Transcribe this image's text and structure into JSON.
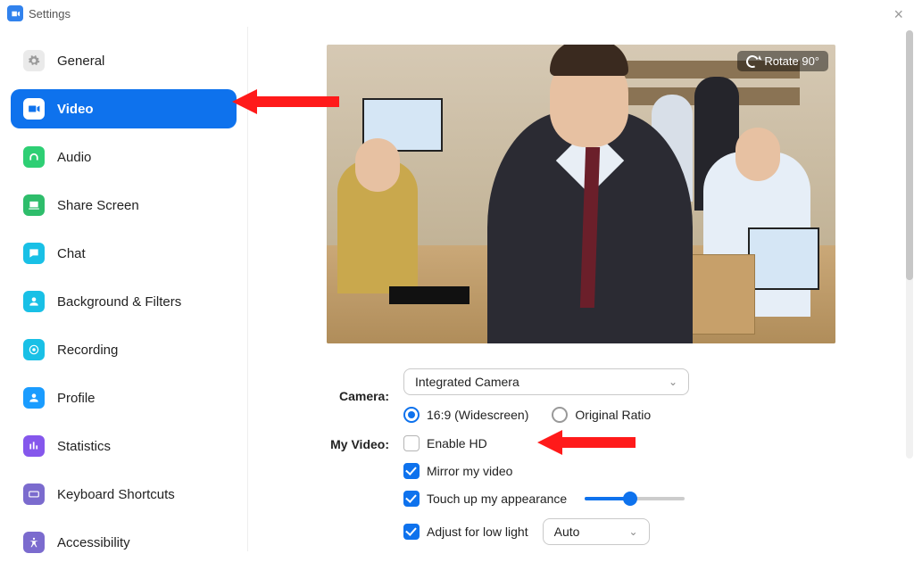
{
  "window": {
    "title": "Settings",
    "close": "×"
  },
  "sidebar": {
    "items": [
      {
        "label": "General",
        "icon_bg": "#eaeaea",
        "icon": "gear",
        "active": false,
        "icon_fill": "#9a9a9a"
      },
      {
        "label": "Video",
        "icon_bg": "#ffffff",
        "icon": "video",
        "active": true,
        "icon_fill": "#0e72ed"
      },
      {
        "label": "Audio",
        "icon_bg": "#2ecf74",
        "icon": "head",
        "active": false
      },
      {
        "label": "Share Screen",
        "icon_bg": "#2ebd6b",
        "icon": "share",
        "active": false
      },
      {
        "label": "Chat",
        "icon_bg": "#19c0e6",
        "icon": "chat",
        "active": false
      },
      {
        "label": "Background & Filters",
        "icon_bg": "#19c0e6",
        "icon": "user",
        "active": false
      },
      {
        "label": "Recording",
        "icon_bg": "#19c0e6",
        "icon": "rec",
        "active": false
      },
      {
        "label": "Profile",
        "icon_bg": "#1a9cff",
        "icon": "profile",
        "active": false
      },
      {
        "label": "Statistics",
        "icon_bg": "#8557ec",
        "icon": "stats",
        "active": false
      },
      {
        "label": "Keyboard Shortcuts",
        "icon_bg": "#7b6bce",
        "icon": "kb",
        "active": false
      },
      {
        "label": "Accessibility",
        "icon_bg": "#7b6bce",
        "icon": "access",
        "active": false
      }
    ]
  },
  "preview": {
    "rotate_label": "Rotate 90°"
  },
  "form": {
    "camera_label": "Camera:",
    "camera_value": "Integrated Camera",
    "aspect": {
      "widescreen": "16:9 (Widescreen)",
      "original": "Original Ratio",
      "selected": "widescreen"
    },
    "myvideo_label": "My Video:",
    "options": {
      "enable_hd": {
        "label": "Enable HD",
        "checked": false
      },
      "mirror": {
        "label": "Mirror my video",
        "checked": true
      },
      "touchup": {
        "label": "Touch up my appearance",
        "checked": true,
        "slider": 45
      },
      "lowlight": {
        "label": "Adjust for low light",
        "checked": true,
        "select": "Auto"
      }
    }
  }
}
